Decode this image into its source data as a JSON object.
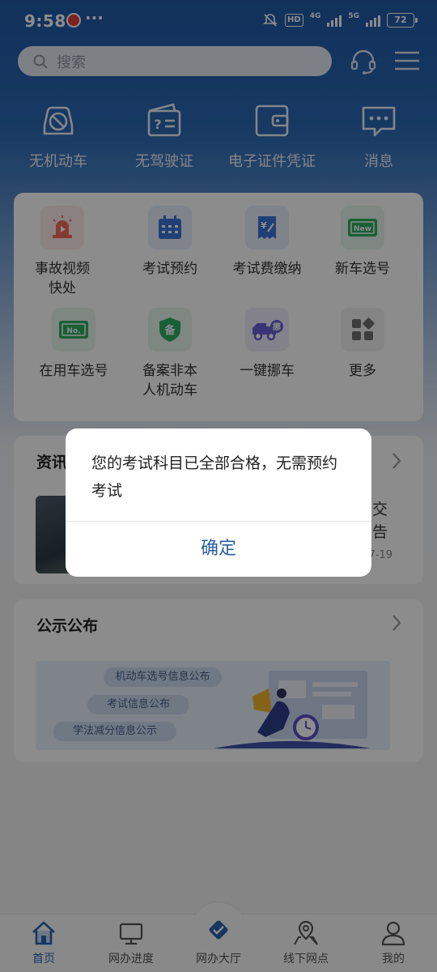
{
  "status_bar": {
    "time": "9:58",
    "dots": "···",
    "hd_label": "HD",
    "net1": "4G",
    "net2": "5G",
    "battery": "72"
  },
  "search": {
    "placeholder": "搜索"
  },
  "quick_items": [
    {
      "label": "无机动车",
      "icon": "car-crossed-icon"
    },
    {
      "label": "无驾驶证",
      "icon": "license-question-icon"
    },
    {
      "label": "电子证件凭证",
      "icon": "wallet-icon"
    },
    {
      "label": "消息",
      "icon": "message-icon"
    }
  ],
  "services": [
    {
      "label_line1": "事故视频",
      "label_line2": "快处",
      "icon": "siren-video-icon",
      "color": "#f26b5b",
      "bg": "#fdecea"
    },
    {
      "label_line1": "考试预约",
      "label_line2": "",
      "icon": "calendar-icon",
      "color": "#3b74d8",
      "bg": "#e7effc"
    },
    {
      "label_line1": "考试费缴纳",
      "label_line2": "",
      "icon": "receipt-icon",
      "color": "#3b74d8",
      "bg": "#e7effc"
    },
    {
      "label_line1": "新车选号",
      "label_line2": "",
      "icon": "new-plate-icon",
      "color": "#2fae63",
      "bg": "#e6f6ec"
    },
    {
      "label_line1": "在用车选号",
      "label_line2": "",
      "icon": "no-plate-icon",
      "color": "#2fae63",
      "bg": "#e6f6ec"
    },
    {
      "label_line1": "备案非本",
      "label_line2": "人机动车",
      "icon": "shield-record-icon",
      "color": "#2fae63",
      "bg": "#e6f6ec"
    },
    {
      "label_line1": "一键挪车",
      "label_line2": "",
      "icon": "tow-truck-icon",
      "color": "#6b5fd6",
      "bg": "#eeecfb"
    },
    {
      "label_line1": "更多",
      "label_line2": "",
      "icon": "grid-more-icon",
      "color": "#666666",
      "bg": "#f0f0f0"
    }
  ],
  "news": {
    "title": "资讯",
    "frag1": "交",
    "frag2": "告",
    "date": "7-19"
  },
  "notice": {
    "title": "公示公布",
    "pills": [
      "机动车选号信息公布",
      "考试信息公布",
      "学法减分信息公示"
    ]
  },
  "dialog": {
    "message": "您的考试科目已全部合格，无需预约考试",
    "confirm": "确定"
  },
  "bottom_nav": [
    {
      "label": "首页",
      "icon": "home-icon",
      "active": true
    },
    {
      "label": "网办进度",
      "icon": "monitor-icon",
      "active": false
    },
    {
      "label": "网办大厅",
      "icon": "hall-icon",
      "active": false
    },
    {
      "label": "线下网点",
      "icon": "map-pin-icon",
      "active": false
    },
    {
      "label": "我的",
      "icon": "user-icon",
      "active": false
    }
  ],
  "colors": {
    "brand": "#1f5aa6",
    "dialog_button": "#2a5f9e",
    "nav_active": "#2a63b0"
  }
}
